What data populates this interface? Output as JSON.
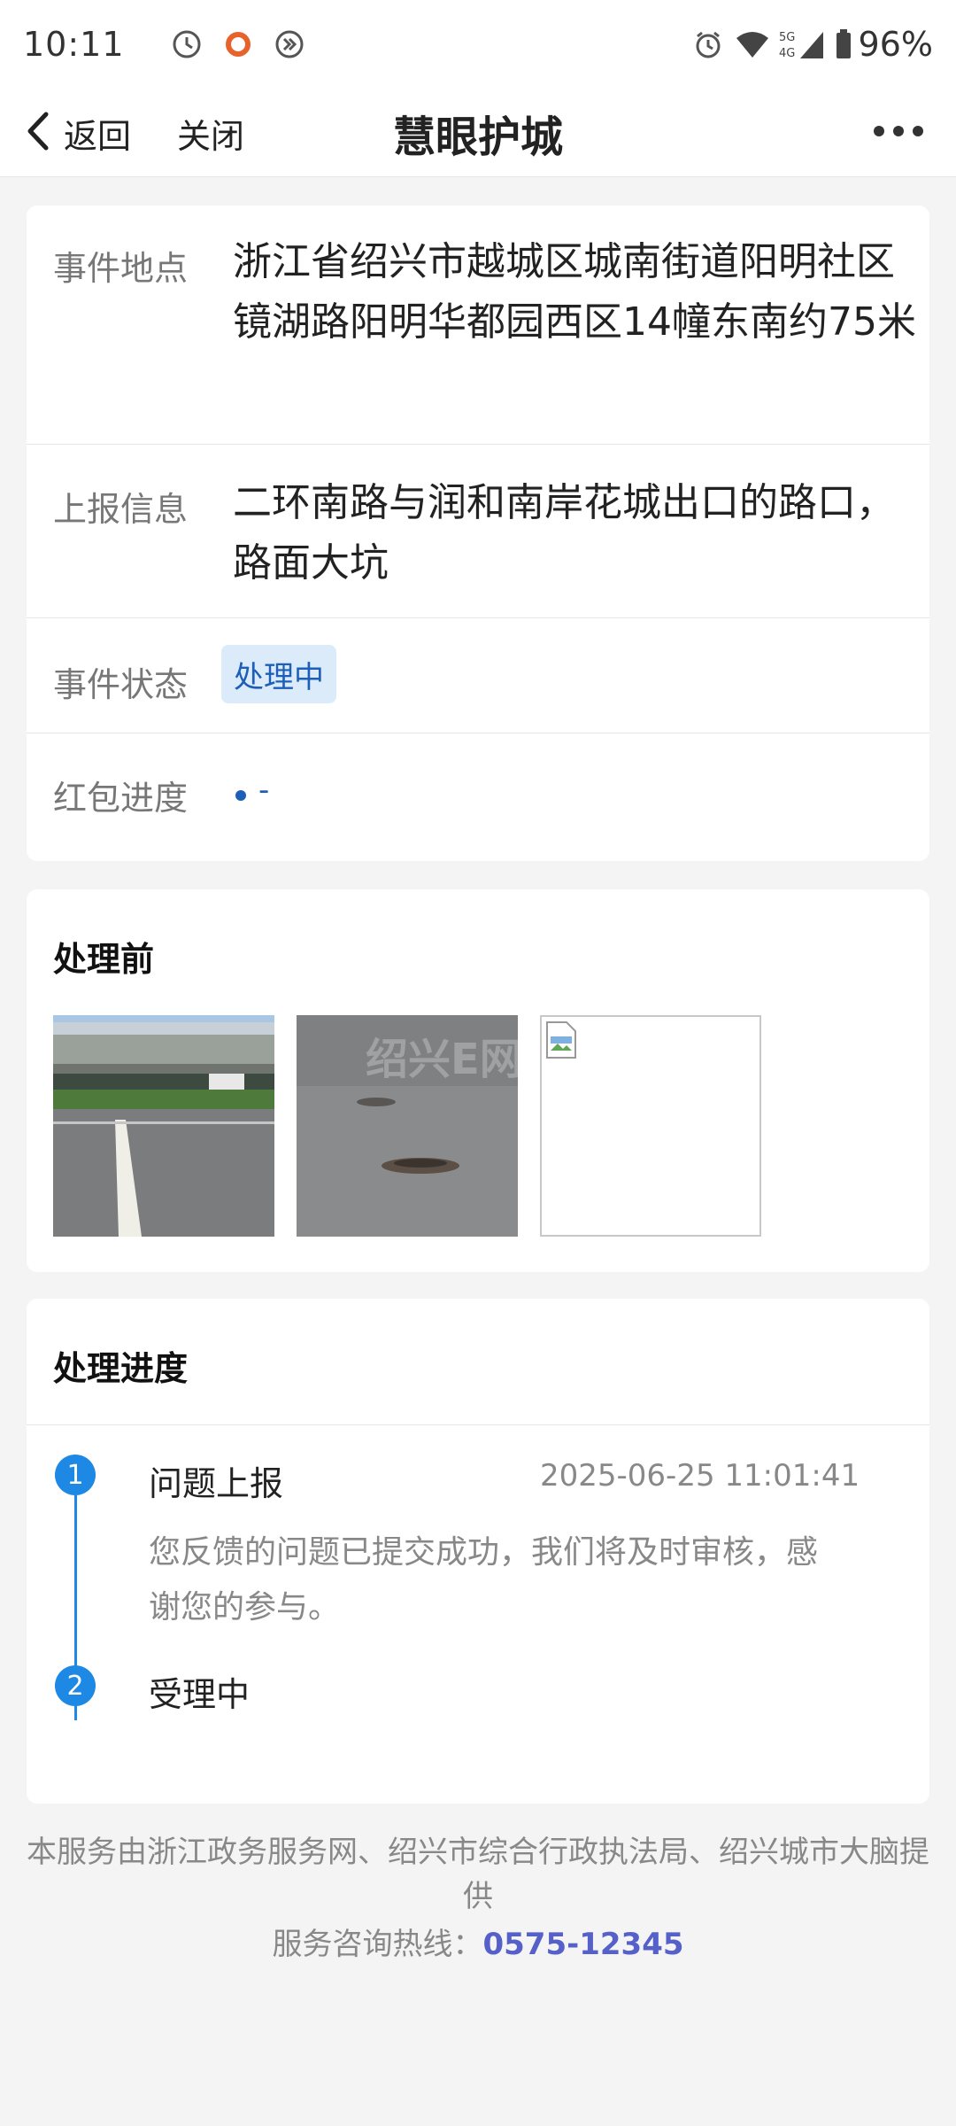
{
  "status_bar": {
    "time": "10:11",
    "battery": "96%",
    "network": "5G 4G"
  },
  "nav": {
    "back_label": "返回",
    "close_label": "关闭",
    "title": "慧眼护城"
  },
  "info": {
    "location_label": "事件地点",
    "location_value": "浙江省绍兴市越城区城南街道阳明社区镜湖路阳明华都园西区14幢东南约75米",
    "report_label": "上报信息",
    "report_value": "二环南路与润和南岸花城出口的路口，路面大坑",
    "status_label": "事件状态",
    "status_value": "处理中",
    "redpack_label": "红包进度",
    "redpack_value": "-"
  },
  "before": {
    "title": "处理前",
    "images": [
      "overpass-road-photo",
      "pothole-photo",
      "broken-image"
    ]
  },
  "progress": {
    "title": "处理进度",
    "steps": [
      {
        "number": "1",
        "title": "问题上报",
        "time": "2025-06-25 11:01:41",
        "description": "您反馈的问题已提交成功，我们将及时审核，感谢您的参与。"
      },
      {
        "number": "2",
        "title": "受理中"
      }
    ]
  },
  "footer": {
    "provider_text": "本服务由浙江政务服务网、绍兴市综合行政执法局、绍兴城市大脑提供",
    "hotline_label": "服务咨询热线：",
    "hotline_number": "0575-12345"
  },
  "colors": {
    "accent": "#1e88e5",
    "badge_bg": "#dcebfa",
    "badge_text": "#1d5fb8",
    "hotline": "#5560c9"
  }
}
